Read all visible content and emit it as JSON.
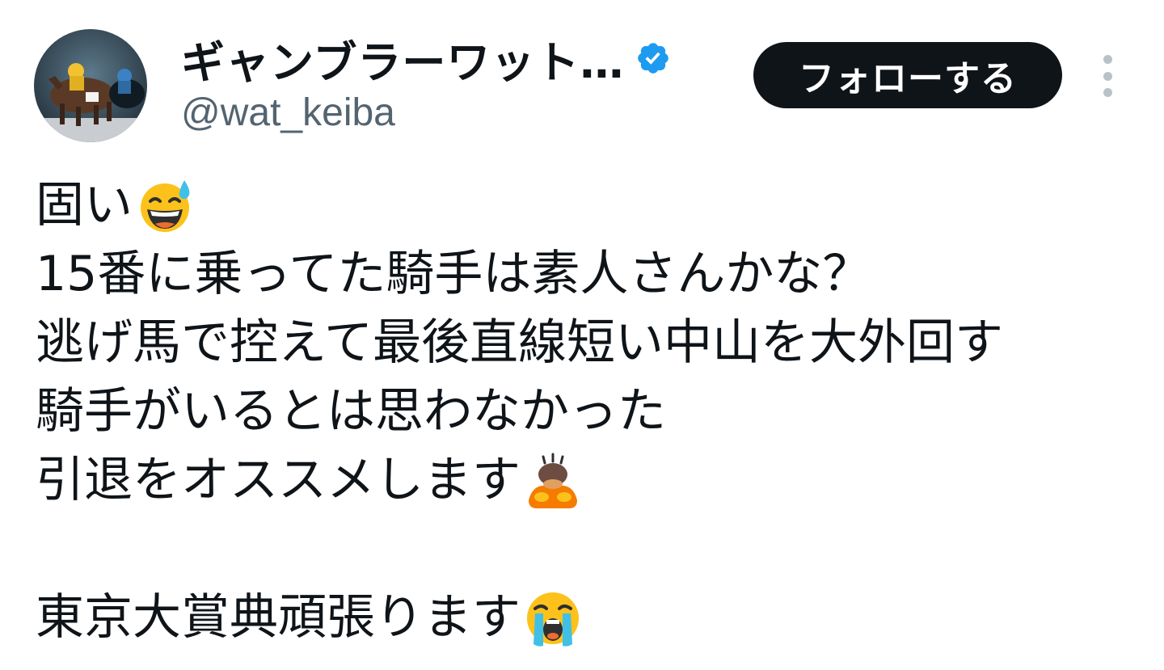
{
  "author": {
    "display_name": "ギャンブラーワット…",
    "handle": "@wat_keiba",
    "avatar_icon": "racehorse-jockey-photo",
    "verified_icon": "verified-badge-icon",
    "verified_color": "#1d9bf0"
  },
  "actions": {
    "follow_label": "フォローする",
    "more_icon": "more-vertical-icon"
  },
  "tweet": {
    "lines": [
      {
        "text": "固い",
        "emoji": "grinning-sweat-emoji"
      },
      {
        "text": "15番に乗ってた騎手は素人さんかな？",
        "emoji": ""
      },
      {
        "text": "逃げ馬で控えて最後直線短い中山を大外回す",
        "emoji": ""
      },
      {
        "text": "騎手がいるとは思わなかった",
        "emoji": ""
      },
      {
        "text": "引退をオススメします",
        "emoji": "person-bowing-emoji"
      },
      {
        "text": "",
        "emoji": ""
      },
      {
        "text": "東京大賞典頑張ります",
        "emoji": "loudly-crying-emoji"
      }
    ]
  },
  "colors": {
    "text_primary": "#0f1419",
    "text_secondary": "#536471",
    "follow_bg": "#0f1419",
    "follow_text": "#ffffff"
  }
}
